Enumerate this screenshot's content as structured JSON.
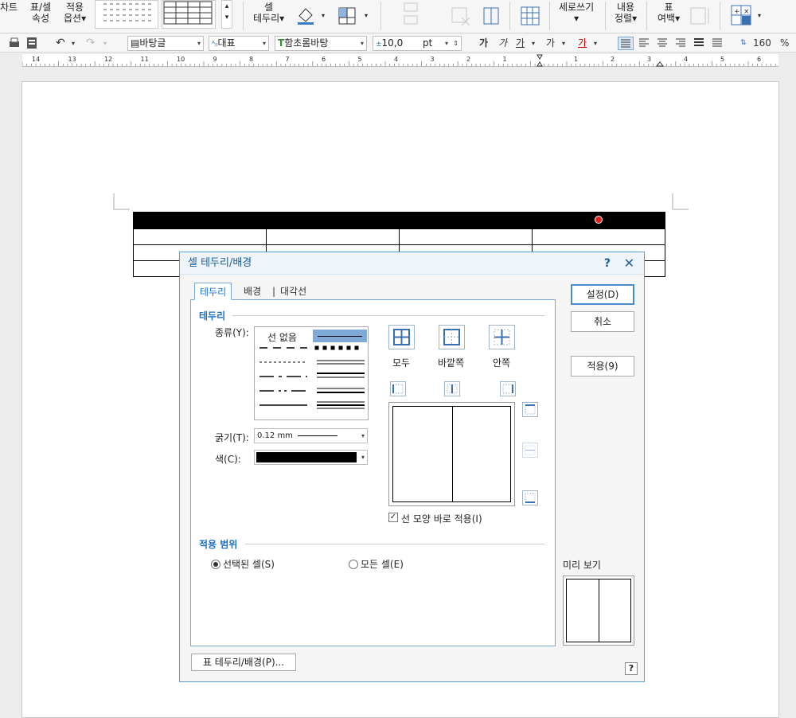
{
  "ribbon": {
    "chart_label": "차트",
    "table_cell_props": "표/셀\n속성",
    "apply_options": "적용\n옵션▾",
    "cell_border": "셀\n테두리▾",
    "vertical_text": "세로쓰기",
    "content_align": "내용\n정렬▾",
    "table_margin": "표\n여백▾"
  },
  "toolbar": {
    "style": "바탕글",
    "representative": "대표",
    "font": "함초롬바탕",
    "font_size": "10,0",
    "size_unit": "pt",
    "bold": "가",
    "italic": "가",
    "underline": "가",
    "strike": "가",
    "color": "가",
    "line_spacing": "160",
    "percent": "%"
  },
  "ruler": {
    "left_numbers": [
      "14",
      "13",
      "12",
      "11",
      "10",
      "9",
      "8",
      "7",
      "6",
      "5",
      "4",
      "3",
      "2",
      "1"
    ],
    "right_numbers": [
      "1",
      "2",
      "3",
      "4",
      "5",
      "6"
    ]
  },
  "dialog": {
    "title": "셀 테두리/배경",
    "help": "?",
    "close": "✕",
    "tabs": [
      "테두리",
      "배경",
      "대각선"
    ],
    "border_section": "테두리",
    "type_label": "종류(Y):",
    "no_line": "선 없음",
    "thickness_label": "굵기(T):",
    "thickness_value": "0.12 mm",
    "color_label": "색(C):",
    "color_value": "#000000",
    "presets": [
      "모두",
      "바깥쪽",
      "안쪽"
    ],
    "apply_immediately": "선 모양 바로 적용(I)",
    "scope_section": "적용 범위",
    "scope_selected": "선택된 셀(S)",
    "scope_all": "모든 셀(E)",
    "preview_label": "미리 보기",
    "btn_set": "설정(D)",
    "btn_cancel": "취소",
    "btn_apply": "적용(9)",
    "btn_table_border": "표 테두리/배경(P)...",
    "help_icon": "?"
  }
}
